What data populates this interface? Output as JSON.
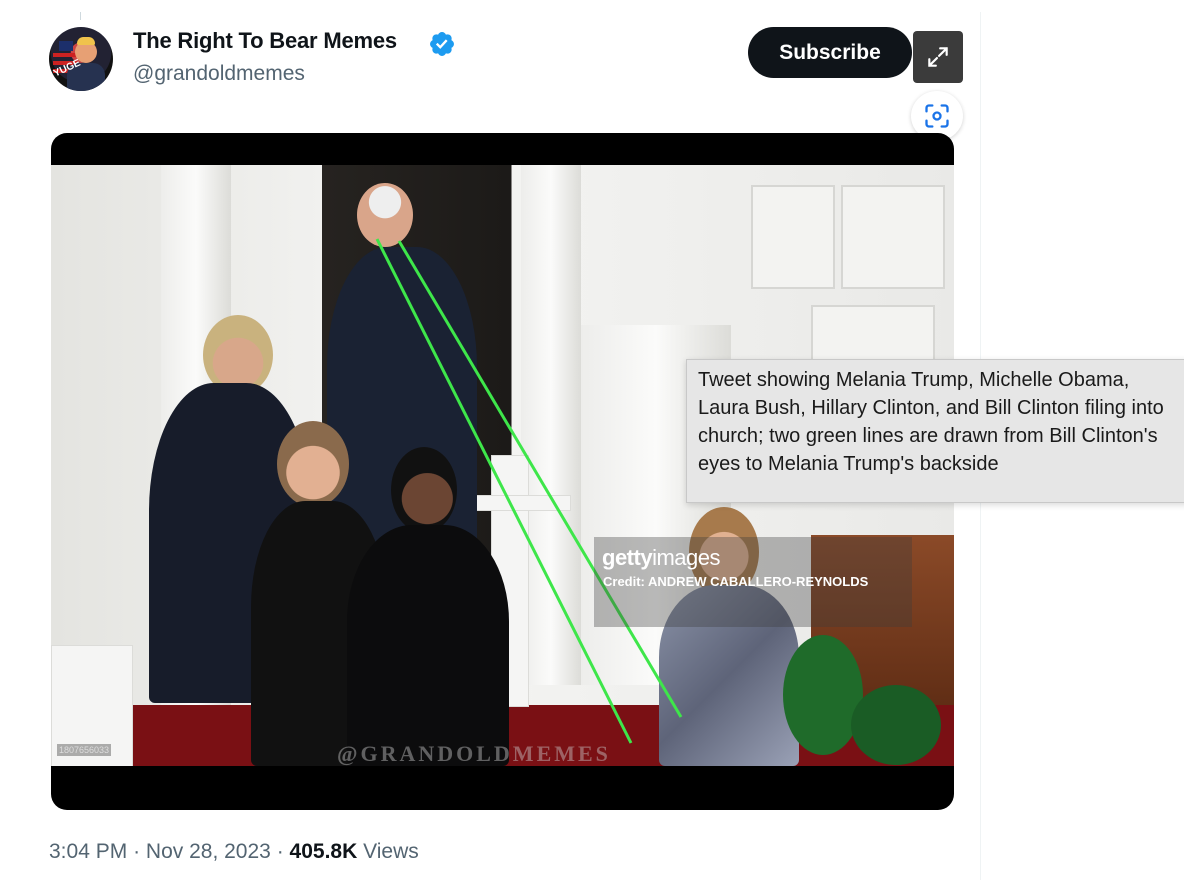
{
  "tweet": {
    "author_name": "The Right To Bear Memes",
    "handle": "@grandoldmemes",
    "avatar_text": "YUGE",
    "subscribe_label": "Subscribe",
    "time": "3:04 PM",
    "separator": "·",
    "date": "Nov 28, 2023",
    "views_count": "405.8K",
    "views_label": "Views",
    "verified_color": "#1d9bf0"
  },
  "media": {
    "getty_brand_bold": "getty",
    "getty_brand_light": "images",
    "getty_credit": "Credit: ANDREW CABALLERO-REYNOLDS",
    "image_id": "1807656033",
    "watermark": "@GRANDOLDMEMES",
    "line_color": "#3ee64a"
  },
  "tooltip": {
    "text": "Tweet showing Melania Trump, Michelle Obama, Laura Bush, Hillary Clinton, and Bill Clinton filing into church; two green lines are drawn from Bill Clinton's eyes to Melania Trump's backside"
  },
  "icons": {
    "expand": "expand-icon",
    "scan": "visual-search-icon",
    "verified": "verified-badge-icon"
  }
}
